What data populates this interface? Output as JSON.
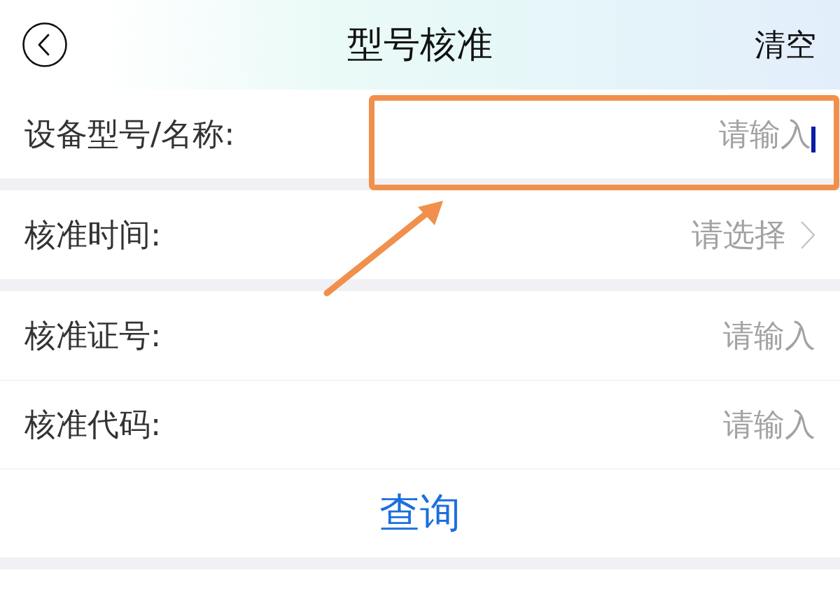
{
  "header": {
    "title": "型号核准",
    "action": "清空"
  },
  "sections": [
    {
      "fields": [
        {
          "kind": "input",
          "label": "设备型号/名称:",
          "placeholder": "请输入",
          "focused": true,
          "highlighted": true
        }
      ]
    },
    {
      "fields": [
        {
          "kind": "select",
          "label": "核准时间:",
          "placeholder": "请选择",
          "focused": false,
          "highlighted": false
        }
      ]
    },
    {
      "fields": [
        {
          "kind": "input",
          "label": "核准证号:",
          "placeholder": "请输入",
          "focused": false,
          "highlighted": false
        },
        {
          "kind": "input",
          "label": "核准代码:",
          "placeholder": "请输入",
          "focused": false,
          "highlighted": false
        }
      ]
    }
  ],
  "query_button": {
    "label": "查询"
  }
}
